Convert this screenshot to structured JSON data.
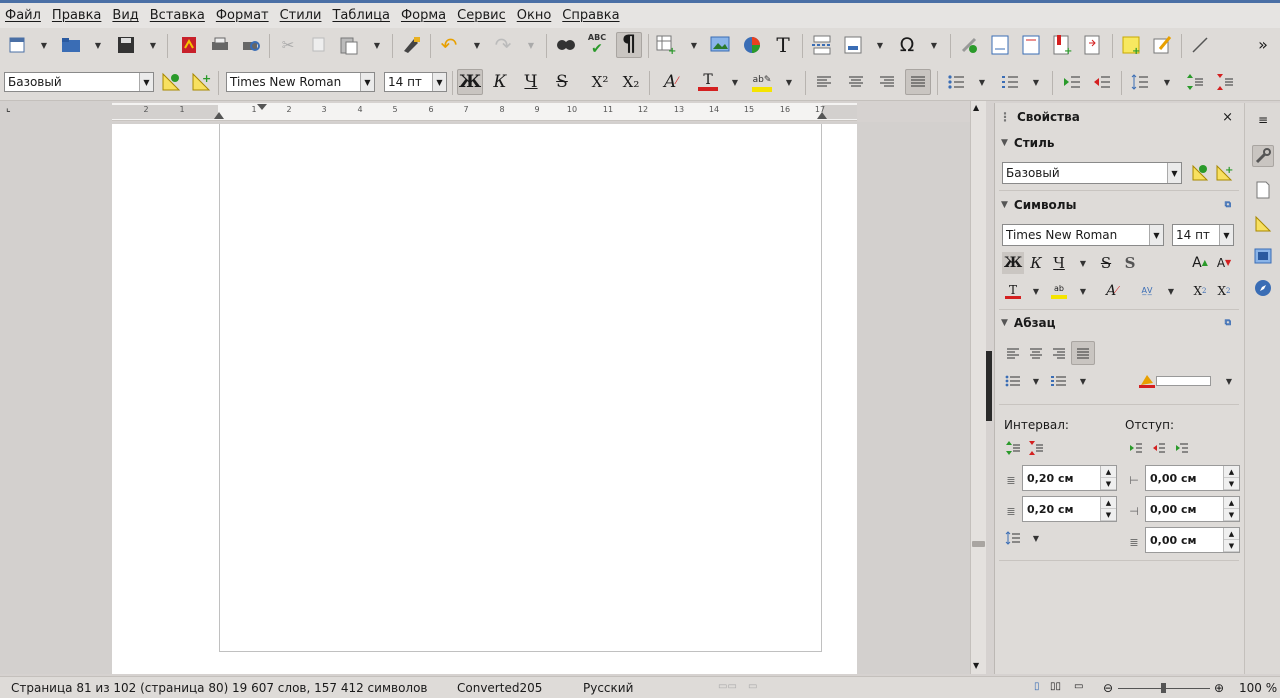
{
  "menu": [
    "Файл",
    "Правка",
    "Вид",
    "Вставка",
    "Формат",
    "Стили",
    "Таблица",
    "Форма",
    "Сервис",
    "Окно",
    "Справка"
  ],
  "formatting": {
    "paragraph_style": "Базовый",
    "font_name": "Times New Roman",
    "font_size": "14 пт",
    "bold": "Ж",
    "italic": "К",
    "underline": "Ч",
    "strike": "S",
    "superscript": "X²",
    "subscript": "X₂"
  },
  "toolbar": {
    "special_char": "Ω",
    "text_box": "T",
    "spelling": "ABC",
    "pilcrow": "¶"
  },
  "ruler": {
    "labels": [
      "2",
      "1",
      "1",
      "2",
      "3",
      "4",
      "5",
      "6",
      "7",
      "8",
      "9",
      "10",
      "11",
      "12",
      "13",
      "14",
      "15",
      "16",
      "17"
    ]
  },
  "sidebar": {
    "title": "Свойства",
    "close": "×",
    "style_section": {
      "title": "Стиль",
      "value": "Базовый"
    },
    "symbols_section": {
      "title": "Символы",
      "font": "Times New Roman",
      "size": "14 пт",
      "bold": "Ж",
      "italic": "К",
      "underline": "Ч",
      "strike": "S",
      "shadow": "S"
    },
    "paragraph_section": {
      "title": "Абзац",
      "spacing_label": "Интервал:",
      "indent_label": "Отступ:",
      "above": "0,20 см",
      "below": "0,20 см",
      "indent_before": "0,00 см",
      "indent_after": "0,00 см",
      "first_line": "0,00 см"
    }
  },
  "status": {
    "page": "Страница 81 из 102 (страница 80)",
    "words": "19 607 слов, 157 412 символов",
    "style": "Converted205",
    "language": "Русский",
    "zoom": "100 %"
  },
  "colors": {
    "font_color": "#d42020",
    "highlight": "#f5e400",
    "accent": "#4a6fa5"
  }
}
